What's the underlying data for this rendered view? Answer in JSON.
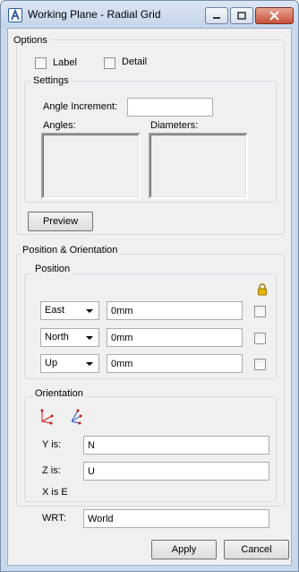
{
  "window": {
    "title": "Working Plane - Radial Grid"
  },
  "options": {
    "group_label": "Options",
    "label_checkbox": "Label",
    "detail_checkbox": "Detail",
    "settings": {
      "group_label": "Settings",
      "angle_increment_label": "Angle Increment:",
      "angle_increment_value": "",
      "angles_label": "Angles:",
      "diameters_label": "Diameters:",
      "preview_button": "Preview"
    }
  },
  "position_orientation": {
    "group_label": "Position & Orientation",
    "position": {
      "group_label": "Position",
      "rows": [
        {
          "direction": "East",
          "value": "0mm"
        },
        {
          "direction": "North",
          "value": "0mm"
        },
        {
          "direction": "Up",
          "value": "0mm"
        }
      ]
    },
    "orientation": {
      "group_label": "Orientation",
      "y_label": "Y is:",
      "y_value": "N",
      "z_label": "Z is:",
      "z_value": "U",
      "x_text": "X is E"
    },
    "wrt_label": "WRT:",
    "wrt_value": "World"
  },
  "buttons": {
    "apply": "Apply",
    "cancel": "Cancel"
  },
  "colors": {
    "lock": "#e8b400",
    "axis_red": "#d01818",
    "axis_blue": "#2050c8"
  }
}
